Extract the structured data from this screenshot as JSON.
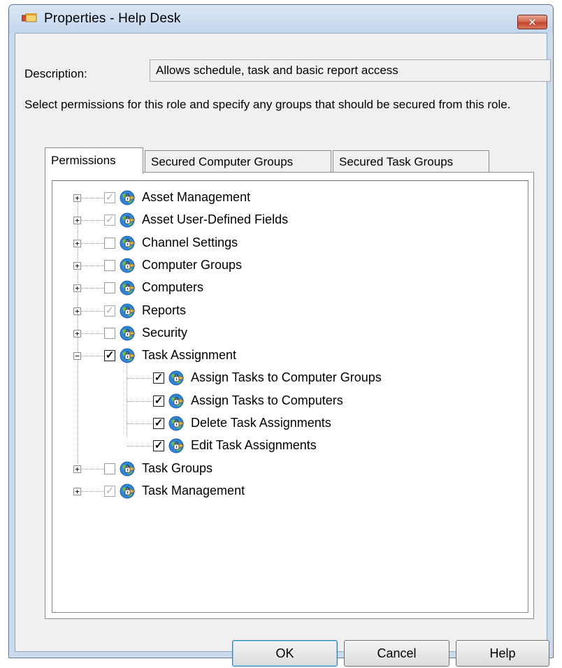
{
  "window": {
    "title": "Properties - Help Desk",
    "close_glyph": "✕",
    "accent_color": "#c9daed"
  },
  "description": {
    "label": "Description:",
    "value": "Allows schedule, task and basic report access"
  },
  "instructions": "Select permissions for this role and specify any groups that should be secured from this role.",
  "tabs": [
    {
      "label": "Permissions",
      "active": true
    },
    {
      "label": "Secured Computer Groups",
      "active": false
    },
    {
      "label": "Secured Task Groups",
      "active": false
    }
  ],
  "tree": {
    "items": [
      {
        "label": "Asset Management",
        "expander": "+",
        "check": "✓",
        "check_state": "indeterminate",
        "icon": "globe-lock-icon"
      },
      {
        "label": "Asset User-Defined Fields",
        "expander": "+",
        "check": "✓",
        "check_state": "indeterminate",
        "icon": "globe-lock-icon"
      },
      {
        "label": "Channel Settings",
        "expander": "+",
        "check": "",
        "check_state": "unchecked",
        "icon": "globe-lock-icon"
      },
      {
        "label": "Computer Groups",
        "expander": "+",
        "check": "",
        "check_state": "unchecked",
        "icon": "globe-lock-icon"
      },
      {
        "label": "Computers",
        "expander": "+",
        "check": "",
        "check_state": "unchecked",
        "icon": "globe-lock-icon"
      },
      {
        "label": "Reports",
        "expander": "+",
        "check": "✓",
        "check_state": "indeterminate",
        "icon": "globe-lock-icon"
      },
      {
        "label": "Security",
        "expander": "+",
        "check": "",
        "check_state": "unchecked",
        "icon": "globe-lock-icon"
      },
      {
        "label": "Task Assignment",
        "expander": "−",
        "check": "✓",
        "check_state": "checked",
        "icon": "globe-lock-icon",
        "children": [
          {
            "label": "Assign Tasks to Computer Groups",
            "check": "✓",
            "check_state": "checked",
            "icon": "globe-lock-icon"
          },
          {
            "label": "Assign Tasks to Computers",
            "check": "✓",
            "check_state": "checked",
            "icon": "globe-lock-icon"
          },
          {
            "label": "Delete Task Assignments",
            "check": "✓",
            "check_state": "checked",
            "icon": "globe-lock-icon"
          },
          {
            "label": "Edit Task Assignments",
            "check": "✓",
            "check_state": "checked",
            "icon": "globe-lock-icon"
          }
        ]
      },
      {
        "label": "Task Groups",
        "expander": "+",
        "check": "",
        "check_state": "unchecked",
        "icon": "globe-lock-icon"
      },
      {
        "label": "Task Management",
        "expander": "+",
        "check": "✓",
        "check_state": "indeterminate",
        "icon": "globe-lock-icon"
      }
    ]
  },
  "buttons": {
    "ok": "OK",
    "cancel": "Cancel",
    "help": "Help"
  }
}
